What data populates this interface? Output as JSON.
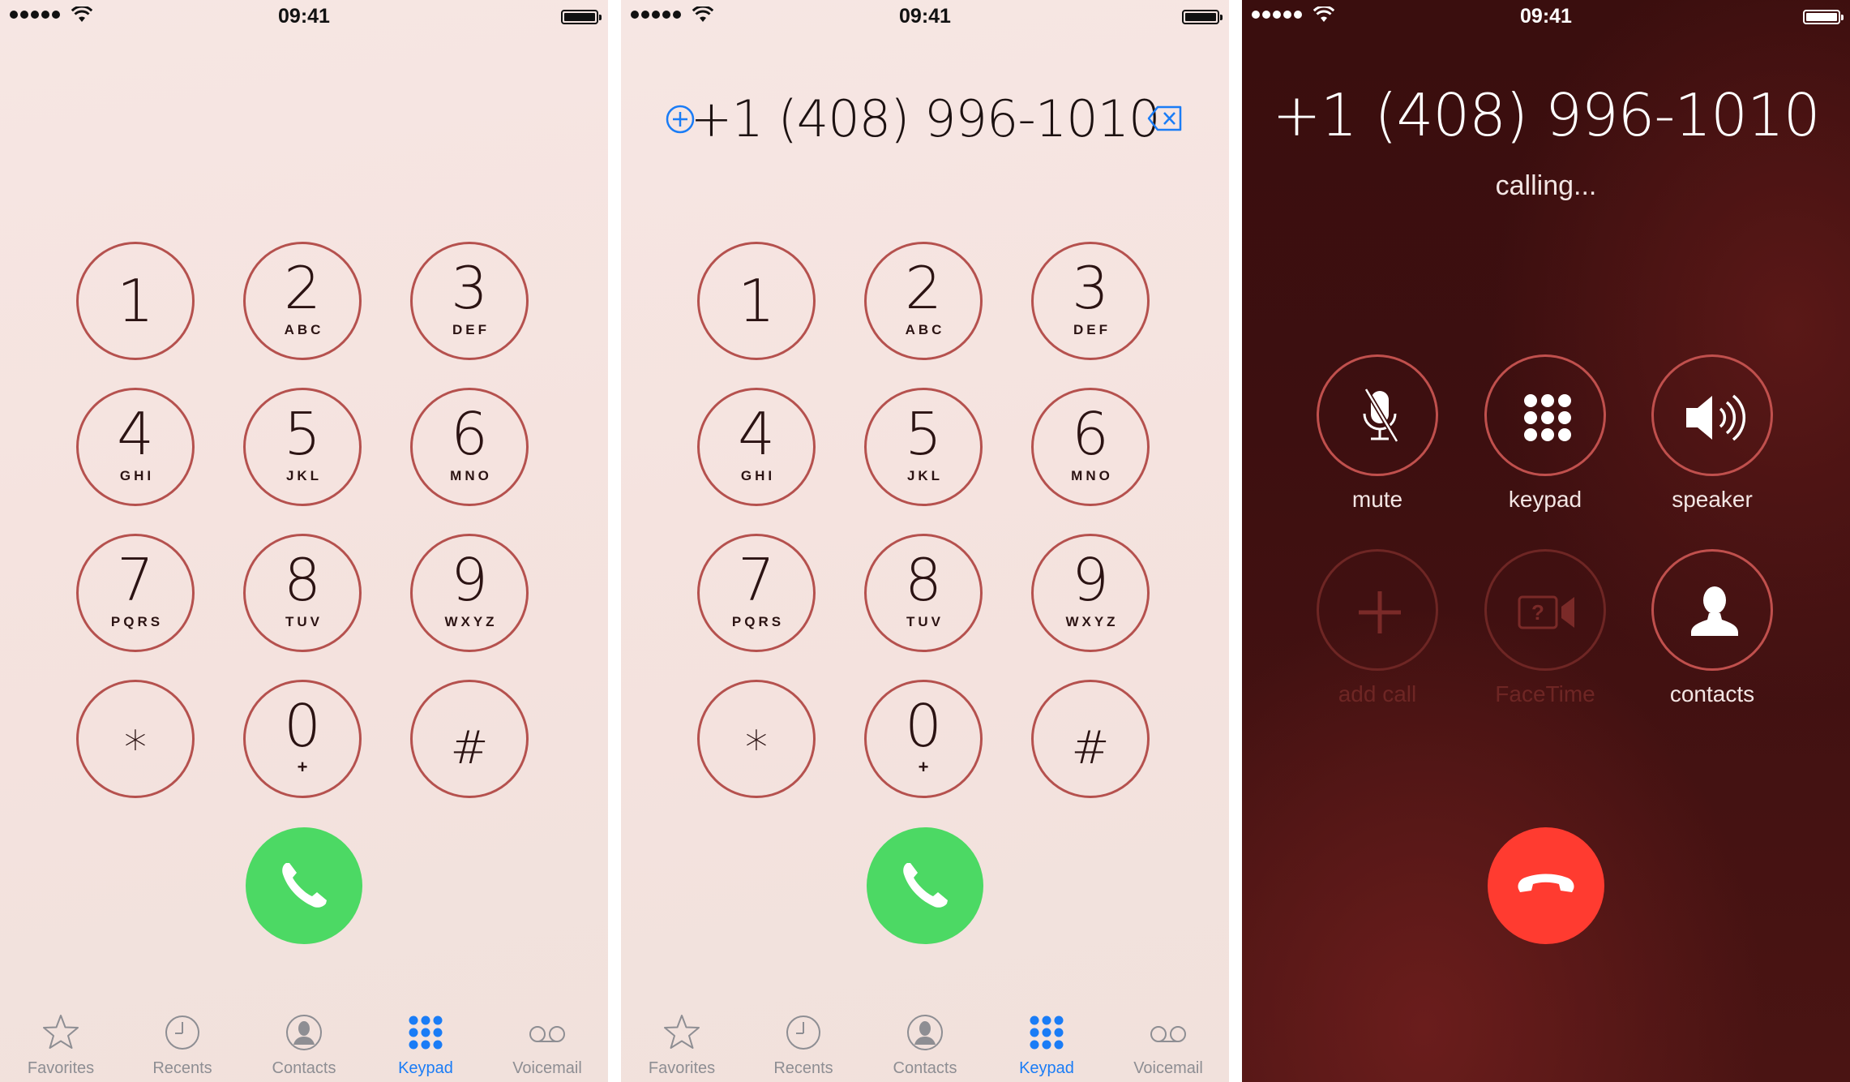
{
  "status_bar": {
    "time": "09:41"
  },
  "keypad": {
    "keys": [
      {
        "digit": "1",
        "letters": ""
      },
      {
        "digit": "2",
        "letters": "ABC"
      },
      {
        "digit": "3",
        "letters": "DEF"
      },
      {
        "digit": "4",
        "letters": "GHI"
      },
      {
        "digit": "5",
        "letters": "JKL"
      },
      {
        "digit": "6",
        "letters": "MNO"
      },
      {
        "digit": "7",
        "letters": "PQRS"
      },
      {
        "digit": "8",
        "letters": "TUV"
      },
      {
        "digit": "9",
        "letters": "WXYZ"
      },
      {
        "digit": "*",
        "letters": ""
      },
      {
        "digit": "0",
        "letters": "+"
      },
      {
        "digit": "#",
        "letters": ""
      }
    ]
  },
  "tabs": [
    {
      "label": "Favorites",
      "icon": "star-icon",
      "active": false
    },
    {
      "label": "Recents",
      "icon": "clock-icon",
      "active": false
    },
    {
      "label": "Contacts",
      "icon": "contacts-icon",
      "active": false
    },
    {
      "label": "Keypad",
      "icon": "keypad-icon",
      "active": true
    },
    {
      "label": "Voicemail",
      "icon": "voicemail-icon",
      "active": false
    }
  ],
  "dialed_number": "+1 (408) 996-1010",
  "call_screen": {
    "number": "+1 (408) 996-1010",
    "status": "calling...",
    "controls": [
      {
        "label": "mute",
        "icon": "mute-icon",
        "enabled": true
      },
      {
        "label": "keypad",
        "icon": "keypad-icon",
        "enabled": true
      },
      {
        "label": "speaker",
        "icon": "speaker-icon",
        "enabled": true
      },
      {
        "label": "add call",
        "icon": "add-icon",
        "enabled": false
      },
      {
        "label": "FaceTime",
        "icon": "facetime-icon",
        "enabled": false
      },
      {
        "label": "contacts",
        "icon": "contact-icon",
        "enabled": true
      }
    ]
  },
  "colors": {
    "accent": "#1a7cf6",
    "call_green": "#4cd964",
    "end_red": "#ff3b30",
    "key_ring": "#b5514e"
  }
}
